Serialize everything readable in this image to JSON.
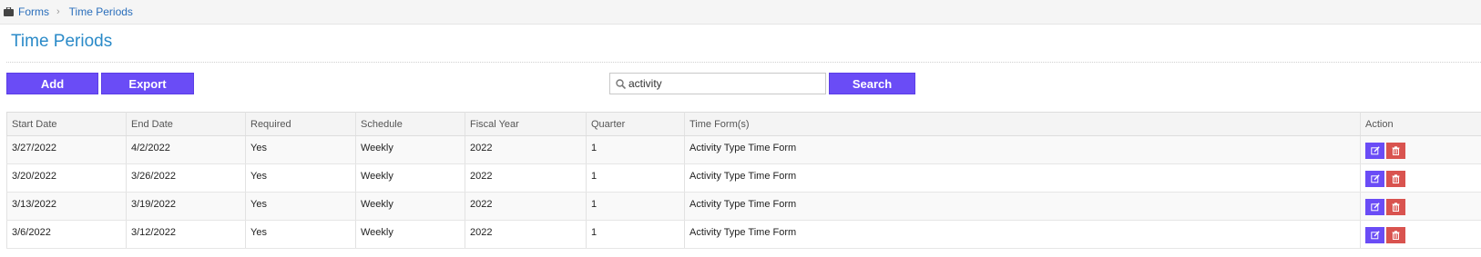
{
  "breadcrumb": {
    "items": [
      "Forms",
      "Time Periods"
    ],
    "separator": "›"
  },
  "page": {
    "title": "Time Periods"
  },
  "toolbar": {
    "add_label": "Add",
    "export_label": "Export",
    "search_label": "Search",
    "search_value": "activity"
  },
  "table": {
    "columns": [
      "Start Date",
      "End Date",
      "Required",
      "Schedule",
      "Fiscal Year",
      "Quarter",
      "Time Form(s)",
      "Action"
    ],
    "rows": [
      [
        "3/27/2022",
        "4/2/2022",
        "Yes",
        "Weekly",
        "2022",
        "1",
        "Activity Type Time Form"
      ],
      [
        "3/20/2022",
        "3/26/2022",
        "Yes",
        "Weekly",
        "2022",
        "1",
        "Activity Type Time Form"
      ],
      [
        "3/13/2022",
        "3/19/2022",
        "Yes",
        "Weekly",
        "2022",
        "1",
        "Activity Type Time Form"
      ],
      [
        "3/6/2022",
        "3/12/2022",
        "Yes",
        "Weekly",
        "2022",
        "1",
        "Activity Type Time Form"
      ]
    ]
  },
  "icons": {
    "breadcrumb": "briefcase-icon",
    "search": "search-icon",
    "edit": "edit-icon",
    "delete": "trash-icon"
  },
  "colors": {
    "primary": "#6a4cf6",
    "danger": "#d9534f",
    "link": "#2a6ebb",
    "title": "#2a8ac8"
  }
}
